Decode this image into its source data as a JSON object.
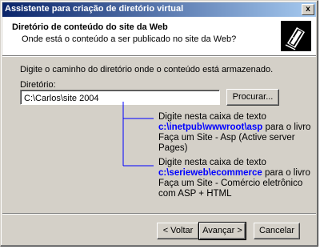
{
  "window": {
    "title": "Assistente para criação de diretório virtual",
    "close_glyph": "x"
  },
  "header": {
    "title": "Diretório de conteúdo do site da Web",
    "subtitle": "Onde está o conteúdo a ser publicado no site da Web?",
    "icon": "book-icon"
  },
  "body": {
    "instruction": "Digite o caminho do diretório onde o conteúdo está armazenado.",
    "directory_label": "Diretório:",
    "directory_value": "C:\\Carlos\\site 2004",
    "browse_label": "Procurar..."
  },
  "annotations": [
    {
      "prefix": "Digite nesta caixa de texto",
      "path": "c:\\inetpub\\wwwroot\\asp",
      "suffix": "para o livro Faça um Site - Asp (Active server Pages)"
    },
    {
      "prefix": "Digite nesta caixa de texto",
      "path": "c:\\serieweb\\ecommerce",
      "suffix": "para o livro Faça um Site - Comércio eletrônico com ASP + HTML"
    }
  ],
  "footer": {
    "back_label": "< Voltar",
    "next_label": "Avançar >",
    "cancel_label": "Cancelar"
  },
  "colors": {
    "path_text": "#0000ff",
    "connector": "#0000ff",
    "title_bar": "#0a246a"
  }
}
